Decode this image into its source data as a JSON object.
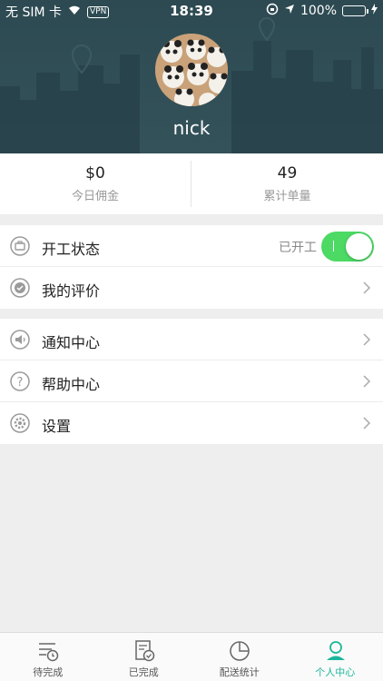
{
  "status_bar": {
    "carrier": "无 SIM 卡",
    "vpn": "VPN",
    "time": "18:39",
    "battery": "100%"
  },
  "profile": {
    "username": "nick"
  },
  "stats": [
    {
      "value": "$0",
      "label": "今日佣金"
    },
    {
      "value": "49",
      "label": "累计单量"
    }
  ],
  "menu_group1": [
    {
      "label": "开工状态",
      "icon": "briefcase-icon",
      "status_text": "已开工",
      "toggle_on": true
    },
    {
      "label": "我的评价",
      "icon": "check-badge-icon"
    }
  ],
  "menu_group2": [
    {
      "label": "通知中心",
      "icon": "speaker-icon"
    },
    {
      "label": "帮助中心",
      "icon": "question-icon"
    },
    {
      "label": "设置",
      "icon": "gear-icon"
    }
  ],
  "tabs": [
    {
      "label": "待完成",
      "icon": "pending-list-icon",
      "active": false
    },
    {
      "label": "已完成",
      "icon": "completed-doc-icon",
      "active": false
    },
    {
      "label": "配送统计",
      "icon": "pie-chart-icon",
      "active": false
    },
    {
      "label": "个人中心",
      "icon": "person-icon",
      "active": true
    }
  ],
  "colors": {
    "header_bg": "#2d4a52",
    "accent": "#1bb69a",
    "toggle_on": "#4cd964"
  }
}
